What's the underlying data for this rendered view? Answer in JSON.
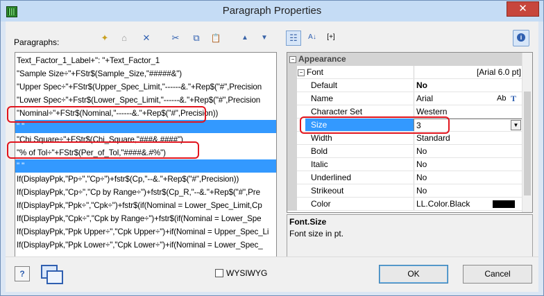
{
  "window": {
    "title": "Paragraph Properties",
    "close_glyph": "✕"
  },
  "left": {
    "label": "Paragraphs:",
    "toolbar": [
      {
        "name": "new-paragraph-icon",
        "glyph": "✦"
      },
      {
        "name": "properties-icon",
        "glyph": "⌂"
      },
      {
        "name": "delete-icon",
        "glyph": "✕"
      },
      {
        "name": "cut-icon",
        "glyph": "✂"
      },
      {
        "name": "copy-icon",
        "glyph": "⧉"
      },
      {
        "name": "paste-icon",
        "glyph": "📋"
      },
      {
        "name": "move-up-icon",
        "glyph": "▲"
      },
      {
        "name": "move-down-icon",
        "glyph": "▼"
      }
    ],
    "lines": [
      "Text_Factor_1_Label+\":   \"+Text_Factor_1",
      "\"Sample Size÷\"+FStr$(Sample_Size,\"#####&\")",
      "\"Upper Spec÷\"+FStr$(Upper_Spec_Limit,\"------&.\"+Rep$(\"#\",Precision",
      "\"Lower Spec÷\"+Fstr$(Lower_Spec_Limit,\"------&.\"+Rep$(\"#\",Precision",
      "\"Nominal÷\"+FStr$(Nominal,\"------&.\"+Rep$(\"#\",Precision))",
      "\" \"",
      "\"Chi Square÷\"+FStr$(Chi_Square,\"###&.####\")",
      "\"% of Tol÷\"+FStr$(Per_of_Tol,\"####&.#%\")",
      "\" \"",
      "If(DisplayPpk,\"Pp÷\",\"Cp÷\")+fstr$(Cp,\"--&.\"+Rep$(\"#\",Precision))",
      "If(DisplayPpk,\"Cp÷\",\"Cp by Range÷\")+fstr$(Cp_R,\"--&.\"+Rep$(\"#\",Pre",
      "If(DisplayPpk,\"Ppk÷\",\"Cpk÷\")+fstr$(if(Nominal = Lower_Spec_Limit,Cp",
      "If(DisplayPpk,\"Cpk÷\",\"Cpk by Range÷\")+fstr$(if(Nominal = Lower_Spe",
      "If(DisplayPpk,\"Ppk Upper÷\",\"Cpk Upper÷\")+if(Nominal = Upper_Spec_Li",
      "If(DisplayPpk,\"Ppk Lower÷\",\"Cpk Lower÷\")+if(Nominal = Lower_Spec_",
      "---"
    ],
    "selected_lines": [
      5,
      8
    ]
  },
  "right": {
    "toolbar": [
      {
        "name": "categorized-view-icon",
        "glyph": "☷"
      },
      {
        "name": "sort-alpha-icon",
        "glyph": "A↓"
      },
      {
        "name": "expand-all-icon",
        "glyph": "[+]"
      }
    ],
    "info_glyph": "i",
    "category": "Appearance",
    "font_row": {
      "name": "Font",
      "value": "[Arial 6.0 pt]"
    },
    "rows": [
      {
        "name": "Default",
        "value": "No",
        "bold": true
      },
      {
        "name": "Name",
        "value": "Arial",
        "extra": "Ab"
      },
      {
        "name": "Character Set",
        "value": "Western"
      },
      {
        "name": "Size",
        "value": "3",
        "selected": true
      },
      {
        "name": "Width",
        "value": "Standard"
      },
      {
        "name": "Bold",
        "value": "No"
      },
      {
        "name": "Italic",
        "value": "No"
      },
      {
        "name": "Underlined",
        "value": "No"
      },
      {
        "name": "Strikeout",
        "value": "No"
      },
      {
        "name": "Color",
        "value": "LL.Color.Black",
        "swatch": "#000000"
      }
    ],
    "description": {
      "title": "Font.Size",
      "text": "Font size in pt."
    }
  },
  "footer": {
    "help_glyph": "?",
    "wysiwyg_label": "WYSIWYG",
    "ok_label": "OK",
    "cancel_label": "Cancel"
  },
  "colors": {
    "selection": "#3399ff",
    "annotation": "#e1141d"
  }
}
